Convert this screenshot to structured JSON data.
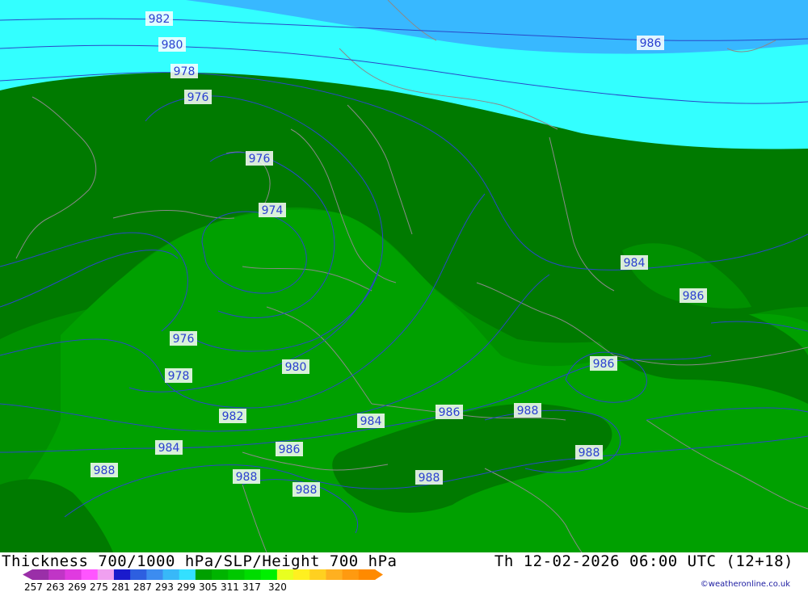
{
  "title": "Thickness 700/1000 hPa/SLP/Height 700 hPa",
  "valid_time": "Th 12-02-2026 06:00 UTC (12+18)",
  "credit": "©weatheronline.co.uk",
  "legend": {
    "values": [
      "257",
      "263",
      "269",
      "275",
      "281",
      "287",
      "293",
      "299",
      "305",
      "311",
      "317",
      "320"
    ],
    "colors": [
      "#9a2fa8",
      "#c035c6",
      "#e03ae0",
      "#ff55ff",
      "#f0a0f0",
      "#1a1acc",
      "#2d5fe0",
      "#3c8cf0",
      "#38b8f8",
      "#33e0ff",
      "#00a000",
      "#00b400",
      "#00c800",
      "#00dc00",
      "#00f000",
      "#e8ff20",
      "#fff020",
      "#ffd020",
      "#ffb020",
      "#ff9a10",
      "#ff8a00"
    ]
  },
  "colors": {
    "cyan_band": "#33ffff",
    "blue_band": "#38b8ff",
    "dark_green": "#007a00",
    "mid_green": "#009000",
    "light_green": "#00a000",
    "isobar": "#2a48c8",
    "border": "#8a8a8a"
  },
  "isobar_labels": [
    {
      "id": "982-top",
      "text": "982"
    },
    {
      "id": "980-top",
      "text": "980"
    },
    {
      "id": "986-ne",
      "text": "986"
    },
    {
      "id": "978-top",
      "text": "978"
    },
    {
      "id": "976-nw",
      "text": "976"
    },
    {
      "id": "976-nl",
      "text": "976"
    },
    {
      "id": "974",
      "text": "974"
    },
    {
      "id": "984-east",
      "text": "984"
    },
    {
      "id": "986-east",
      "text": "986"
    },
    {
      "id": "976-sw",
      "text": "976"
    },
    {
      "id": "978-sw",
      "text": "978"
    },
    {
      "id": "980-center",
      "text": "980"
    },
    {
      "id": "986-cz",
      "text": "986"
    },
    {
      "id": "982-sw",
      "text": "982"
    },
    {
      "id": "984-center",
      "text": "984"
    },
    {
      "id": "986-alps",
      "text": "986"
    },
    {
      "id": "988-alps-e",
      "text": "988"
    },
    {
      "id": "984-fr",
      "text": "984"
    },
    {
      "id": "986-ch",
      "text": "986"
    },
    {
      "id": "988-hu",
      "text": "988"
    },
    {
      "id": "988-fr",
      "text": "988"
    },
    {
      "id": "988-se",
      "text": "988"
    },
    {
      "id": "988-ch",
      "text": "988"
    },
    {
      "id": "988-it",
      "text": "988"
    }
  ]
}
